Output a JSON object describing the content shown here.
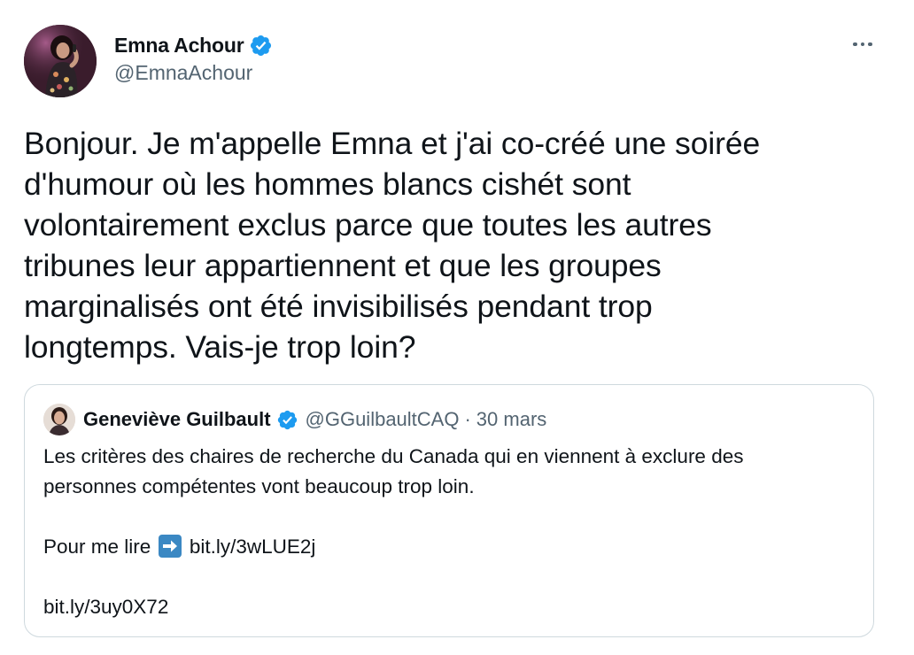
{
  "tweet": {
    "author": {
      "display_name": "Emna Achour",
      "handle": "@EmnaAchour",
      "verified": true
    },
    "text": "Bonjour. Je m'appelle Emna et j'ai co-créé une soirée\nd'humour où les hommes blancs cishét sont\nvolontairement exclus parce que toutes les autres\ntribunes leur appartiennent et que les groupes\nmarginalisés ont été invisibilisés pendant trop\nlongtemps. Vais-je trop loin?",
    "more_icon": "more-horizontal-icon"
  },
  "quote": {
    "author": {
      "display_name": "Geneviève Guilbault",
      "handle": "@GGuilbaultCAQ",
      "verified": true
    },
    "separator": "·",
    "date": "30 mars",
    "lines": {
      "line1": "Les critères des chaires de recherche du Canada qui en viennent à exclure des",
      "line2": "personnes compétentes vont beaucoup trop loin.",
      "line3_prefix": "Pour me lire",
      "line3_emoji": "right-arrow-emoji-icon",
      "line3_link": "bit.ly/3wLUE2j",
      "line4_link": "bit.ly/3uy0X72"
    }
  },
  "colors": {
    "text_primary": "#0f1419",
    "text_secondary": "#536471",
    "verified_blue": "#1d9bf0",
    "border": "#cfd9de",
    "emoji_blue": "#3b88c3"
  }
}
